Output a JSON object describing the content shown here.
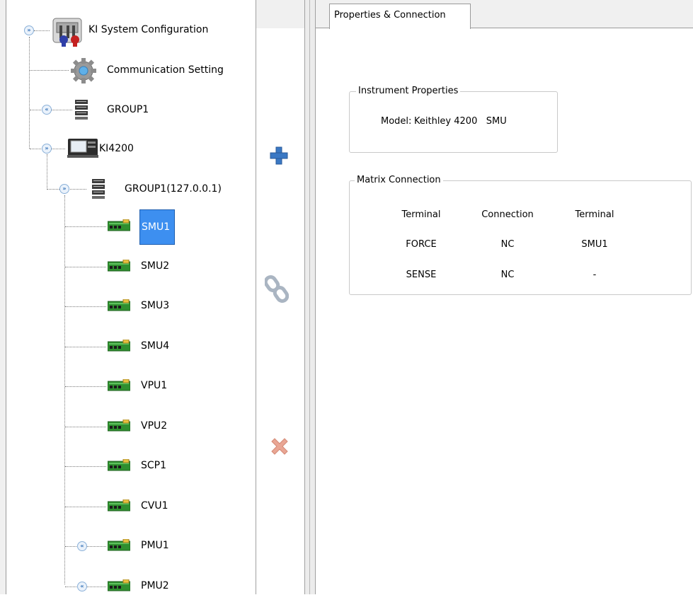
{
  "tree": {
    "root_label": "KI System Configuration",
    "communication_label": "Communication Setting",
    "group1_label": "GROUP1",
    "ki4200_label": "KI4200",
    "group1_ip_label": "GROUP1(127.0.0.1)",
    "cards": [
      "SMU1",
      "SMU2",
      "SMU3",
      "SMU4",
      "VPU1",
      "VPU2",
      "SCP1",
      "CVU1",
      "PMU1",
      "PMU2"
    ],
    "selected": "SMU1"
  },
  "toolbar": {
    "add_icon": "plus-icon",
    "link_icon": "link-icon",
    "delete_icon": "delete-x-icon"
  },
  "tab": {
    "label": "Properties & Connection"
  },
  "instrument": {
    "title": "Instrument Properties",
    "model_label": "Model:",
    "model_value": "Keithley 4200   SMU"
  },
  "matrix": {
    "title": "Matrix Connection",
    "headers": [
      "Terminal",
      "Connection",
      "Terminal"
    ],
    "rows": [
      [
        "FORCE",
        "NC",
        "SMU1"
      ],
      [
        "SENSE",
        "NC",
        "-"
      ]
    ]
  },
  "colors": {
    "selection": "#3d8ff0",
    "plus_blue": "#3a78c4",
    "delete_red": "#e59a86"
  }
}
